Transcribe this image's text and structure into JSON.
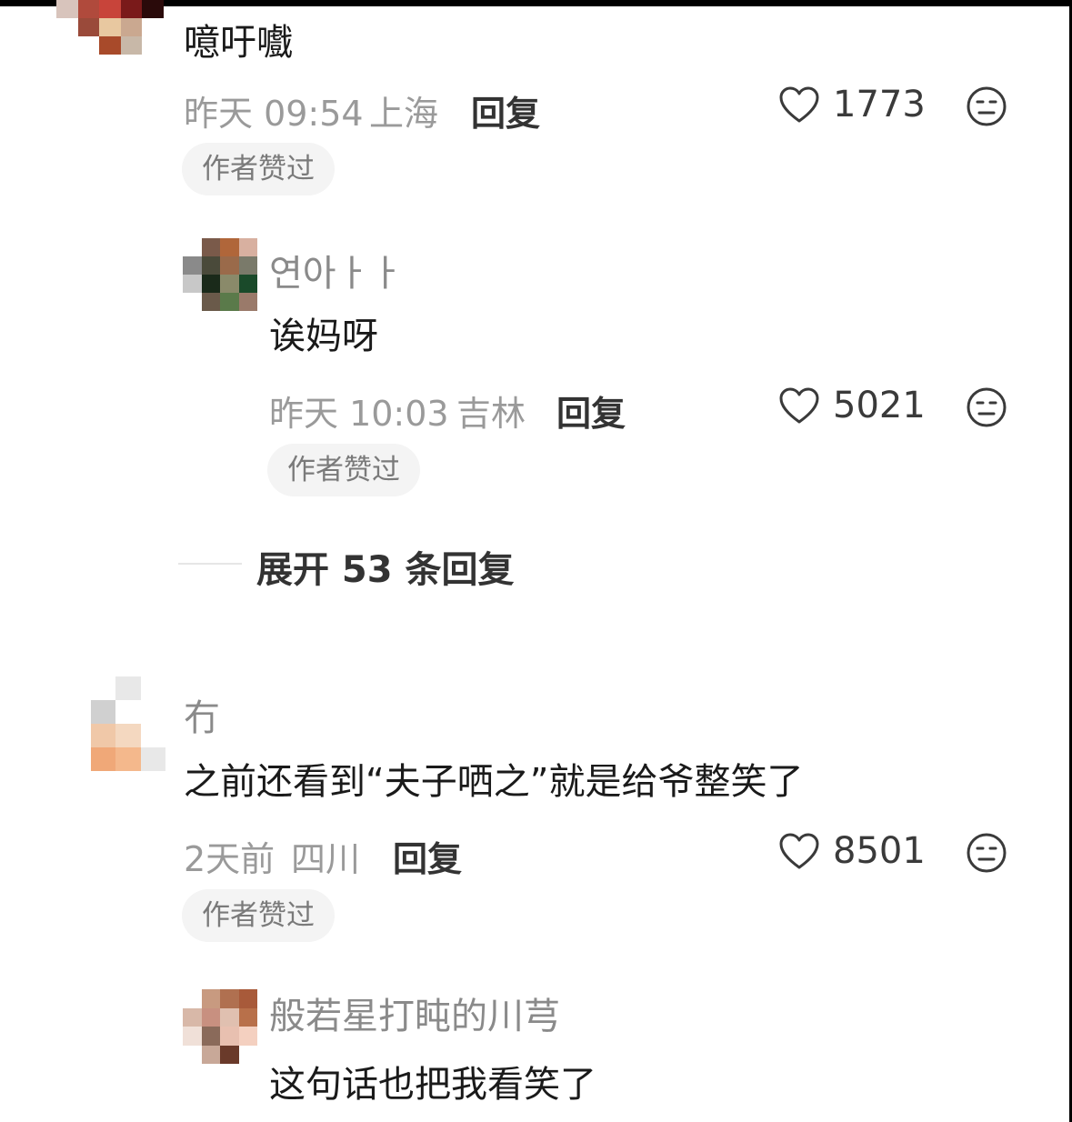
{
  "comments": [
    {
      "text": "噫吁嚱",
      "time": "昨天 09:54",
      "location": "上海",
      "reply_label": "回复",
      "likes": "1773",
      "badge": "作者赞过"
    },
    {
      "username": "연아ㅏㅏ",
      "text": "诶妈呀",
      "time": "昨天 10:03",
      "location": "吉林",
      "reply_label": "回复",
      "likes": "5021",
      "badge": "作者赞过"
    },
    {
      "username": "冇",
      "text": "之前还看到“夫子哂之”就是给爷整笑了",
      "time": "2天前",
      "location": "四川",
      "reply_label": "回复",
      "likes": "8501",
      "badge": "作者赞过"
    },
    {
      "username": "般若星打盹的川芎",
      "text": "这句话也把我看笑了"
    }
  ],
  "expand_replies": "展开 53 条回复",
  "icons": {
    "like": "heart-outline-icon",
    "dislike": "neutral-face-icon"
  },
  "colors": {
    "meta_gray": "#9a9a9a",
    "text_dark": "#1a1a1a",
    "badge_bg": "#f4f4f4"
  }
}
